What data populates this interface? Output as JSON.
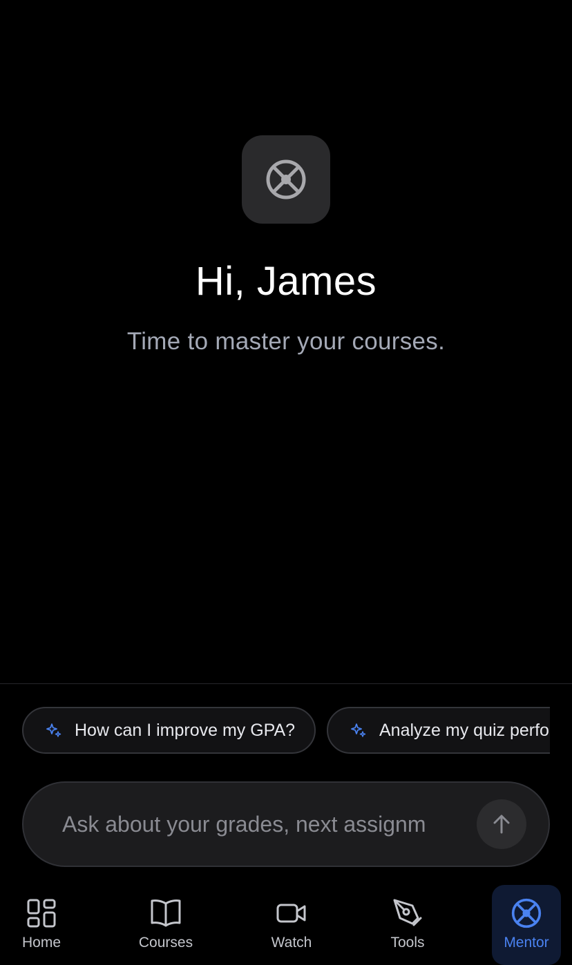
{
  "hero": {
    "greeting": "Hi, James",
    "subtitle": "Time to master your courses.",
    "icon": "steering-wheel-icon"
  },
  "suggestions": [
    {
      "label": "How can I improve my GPA?",
      "icon": "sparkles-icon"
    },
    {
      "label": "Analyze my quiz perfo",
      "icon": "sparkles-icon"
    }
  ],
  "composer": {
    "placeholder": "Ask about your grades, next assignm",
    "send_icon": "arrow-up-icon"
  },
  "nav": {
    "items": [
      {
        "label": "Home",
        "icon": "grid-icon"
      },
      {
        "label": "Courses",
        "icon": "book-icon"
      },
      {
        "label": "Watch",
        "icon": "video-icon"
      },
      {
        "label": "Tools",
        "icon": "pen-tool-icon"
      },
      {
        "label": "Mentor",
        "icon": "steering-wheel-icon",
        "active": true
      }
    ]
  },
  "colors": {
    "background": "#000000",
    "accent": "#4a82f0",
    "text_secondary": "#a4a9b6"
  }
}
